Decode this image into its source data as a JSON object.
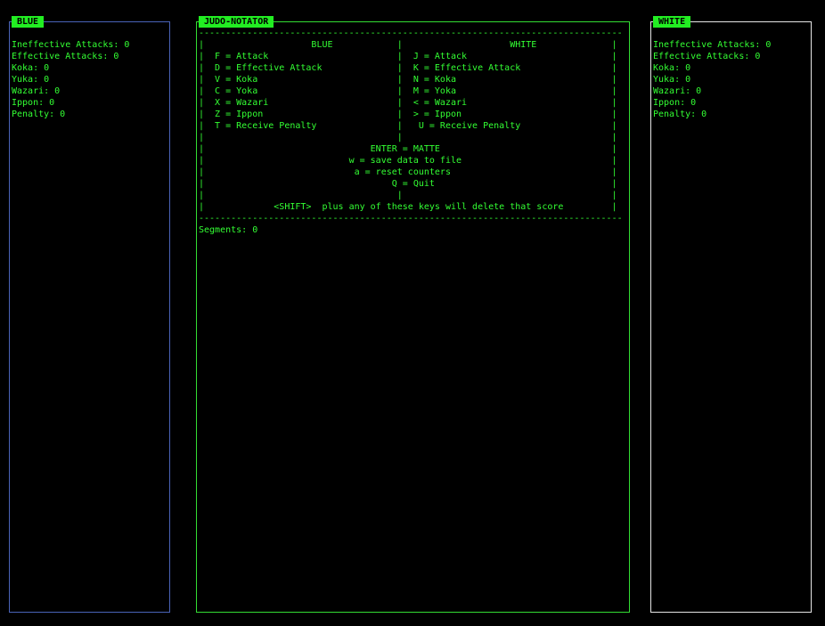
{
  "panels": {
    "blue": {
      "title": "BLUE",
      "stats": [
        "Ineffective Attacks: 0",
        "Effective Attacks: 0",
        "Koka: 0",
        "Yuka: 0",
        "Wazari: 0",
        "Ippon: 0",
        "Penalty: 0"
      ]
    },
    "center": {
      "title": "JUDO-NOTATOR",
      "lines": [
        "-------------------------------------------------------------------------------",
        "|                    BLUE            |                    WHITE              |",
        "|  F = Attack                        |  J = Attack                           |",
        "|  D = Effective Attack              |  K = Effective Attack                 |",
        "|  V = Koka                          |  N = Koka                             |",
        "|  C = Yoka                          |  M = Yoka                             |",
        "|  X = Wazari                        |  < = Wazari                           |",
        "|  Z = Ippon                         |  > = Ippon                            |",
        "|  T = Receive Penalty               |   U = Receive Penalty                 |",
        "|                                    |                                       |",
        "|                               ENTER = MATTE                                |",
        "|                           w = save data to file                            |",
        "|                            a = reset counters                              |",
        "|                                   Q = Quit                                 |",
        "|                                    |                                       |",
        "|             <SHIFT>  plus any of these keys will delete that score         |",
        "-------------------------------------------------------------------------------",
        "Segments: 0"
      ]
    },
    "white": {
      "title": "WHITE",
      "stats": [
        "Ineffective Attacks: 0",
        "Effective Attacks: 0",
        "Koka: 0",
        "Yuka: 0",
        "Wazari: 0",
        "Ippon: 0",
        "Penalty: 0"
      ]
    }
  },
  "colors": {
    "background": "#000000",
    "text": "#33ff33",
    "tab_background": "#22ee22",
    "blue_border": "#4a63b8",
    "center_border": "#33dd33",
    "white_border": "#e6e6e6"
  }
}
